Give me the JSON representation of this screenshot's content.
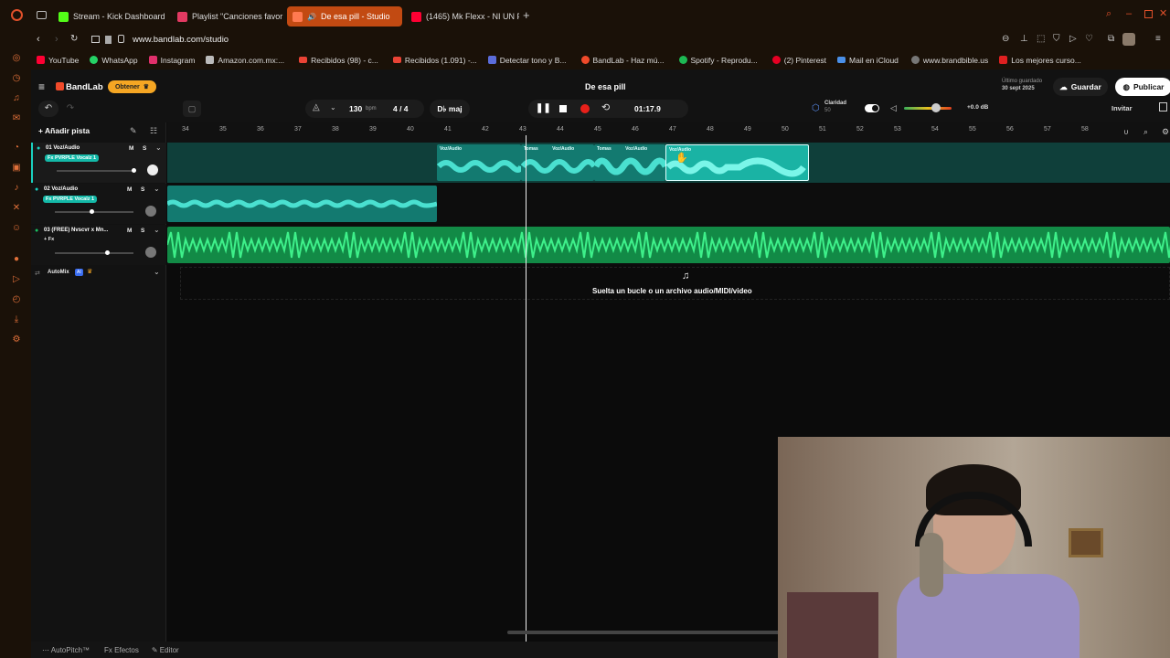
{
  "browser": {
    "tabs": [
      {
        "label": "Stream - Kick Dashboard",
        "color": "#53fc18"
      },
      {
        "label": "Playlist \"Canciones favor",
        "color": "#e23a62"
      },
      {
        "label": "De esa pill - Studio",
        "color": "#f04a2a",
        "active": true
      },
      {
        "label": "(1465) Mk Flexx - NI UN P",
        "color": "#ff0033"
      }
    ],
    "url": "www.bandlab.com/studio",
    "bookmarks": [
      {
        "label": "YouTube",
        "color": "#ff0033"
      },
      {
        "label": "WhatsApp",
        "color": "#25d366"
      },
      {
        "label": "Instagram",
        "color": "#e1306c"
      },
      {
        "label": "Amazon.com.mx:...",
        "color": "#bbbbbb"
      },
      {
        "label": "Recibidos (98) - c...",
        "color": "#ea4335"
      },
      {
        "label": "Recibidos (1.091) -...",
        "color": "#ea4335"
      },
      {
        "label": "Detectar tono y B...",
        "color": "#5b6cd9"
      },
      {
        "label": "BandLab - Haz mú...",
        "color": "#f04a2a"
      },
      {
        "label": "Spotify - Reprodu...",
        "color": "#1db954"
      },
      {
        "label": "(2) Pinterest",
        "color": "#e60023"
      },
      {
        "label": "Mail en iCloud",
        "color": "#4a8fe7"
      },
      {
        "label": "www.brandbible.us",
        "color": "#777777"
      },
      {
        "label": "Los mejores curso...",
        "color": "#e02020"
      }
    ]
  },
  "app": {
    "brand": "BandLab",
    "get_label": "Obtener",
    "project_title": "De esa pill",
    "last_saved_label": "Último guardado",
    "last_saved_date": "30 sept 2025",
    "save_label": "Guardar",
    "publish_label": "Publicar",
    "invite_label": "Invitar",
    "bpm_value": "130",
    "bpm_unit": "bpm",
    "time_sig": "4 / 4",
    "key": "D♭ maj",
    "time": "01:17.9",
    "clarity_label": "Claridad",
    "clarity_value": "50",
    "volume_db": "+0.0 dB",
    "add_track_label": "Añadir pista",
    "drop_hint": "Suelta un bucle o un archivo audio/MIDI/video",
    "automix_label": "AutoMix",
    "automix_badge": "AI",
    "colors": {
      "accent": "#f04a2a",
      "track": "#1a9a8c",
      "beat": "#19c060"
    }
  },
  "tracks": [
    {
      "name": "01 Voz/Audio",
      "fx": "Fx PVRPLE Vocalz 1",
      "mute": "M",
      "solo": "S"
    },
    {
      "name": "02 Voz/Audio",
      "fx": "Fx PVRPLE Vocalz 1",
      "mute": "M",
      "solo": "S"
    },
    {
      "name": "03 (FREE) Nvscvr x Mn...",
      "fx": "+ Fx",
      "mute": "M",
      "solo": "S"
    }
  ],
  "ruler": [
    "34",
    "35",
    "36",
    "37",
    "38",
    "39",
    "40",
    "41",
    "42",
    "43",
    "44",
    "45",
    "46",
    "47",
    "48",
    "49",
    "50",
    "51",
    "52",
    "53",
    "54",
    "55",
    "56",
    "57",
    "58"
  ],
  "clips": {
    "voz": "Voz/Audio",
    "tomas": "Tomas"
  },
  "bottom": {
    "autopitch": "AutoPitch™",
    "effects": "Efectos",
    "editor": "Editor",
    "fx_prefix": "Fx"
  }
}
